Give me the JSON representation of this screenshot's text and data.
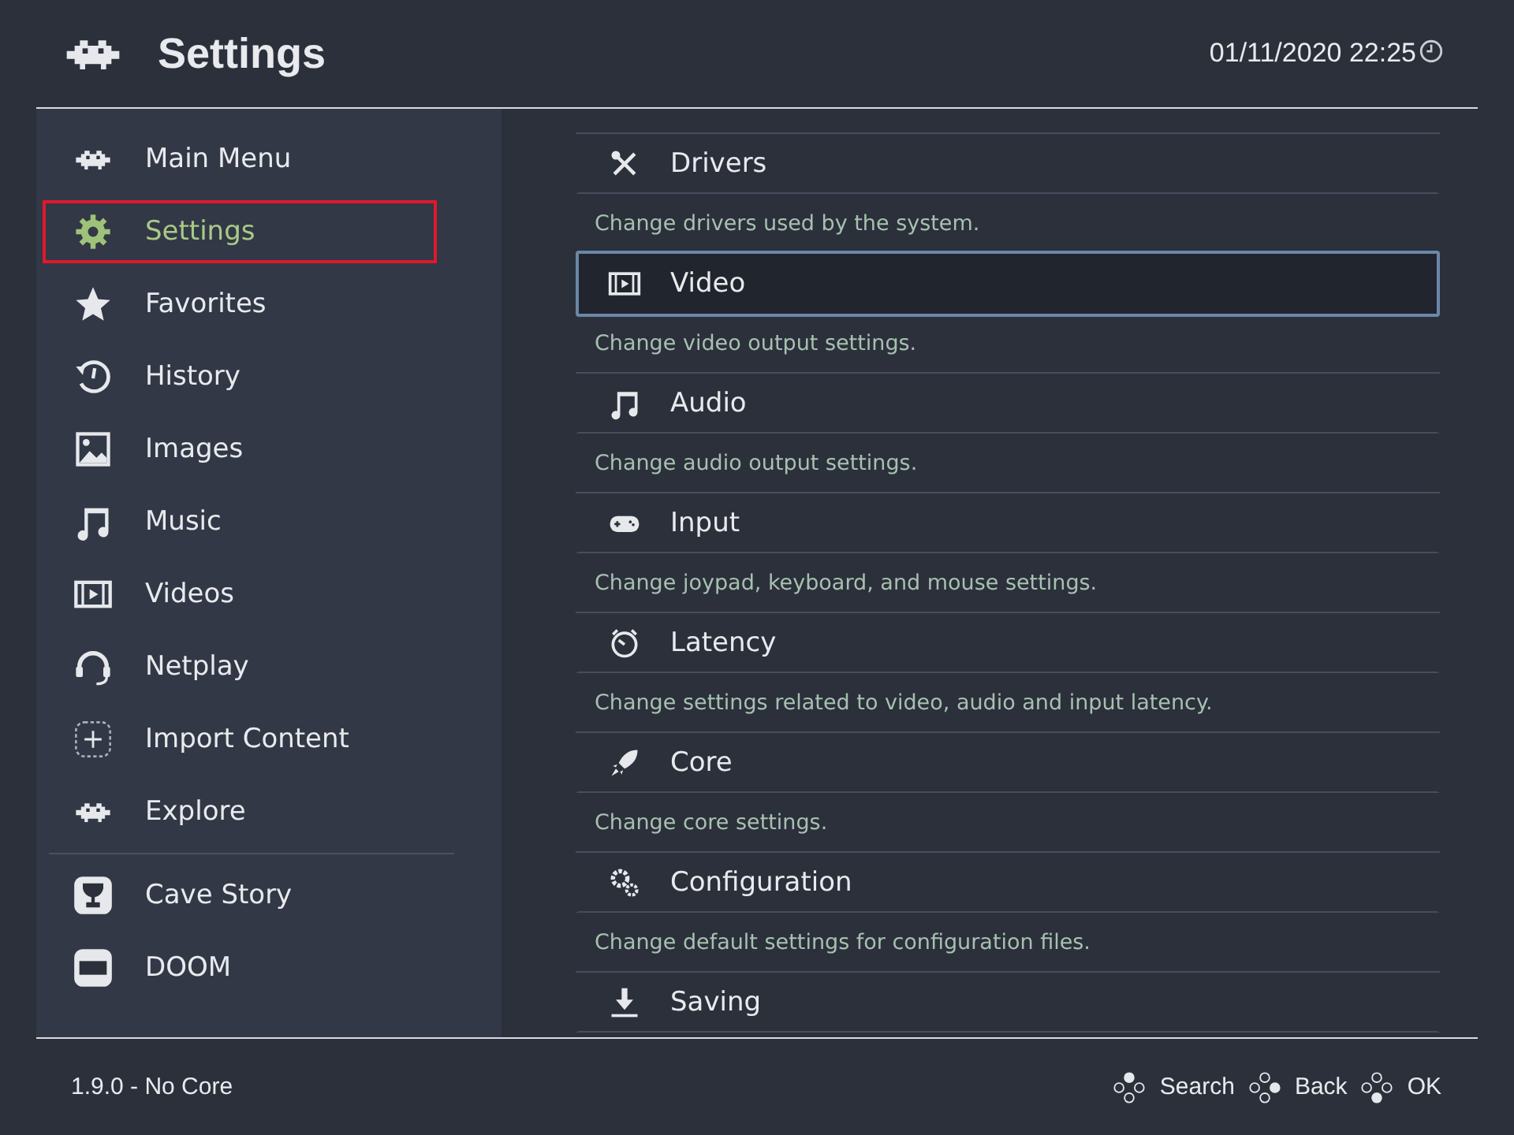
{
  "header": {
    "title": "Settings",
    "datetime": "01/11/2020 22:25"
  },
  "sidebar": {
    "items": [
      {
        "label": "Main Menu",
        "selected": false
      },
      {
        "label": "Settings",
        "selected": true
      },
      {
        "label": "Favorites",
        "selected": false
      },
      {
        "label": "History",
        "selected": false
      },
      {
        "label": "Images",
        "selected": false
      },
      {
        "label": "Music",
        "selected": false
      },
      {
        "label": "Videos",
        "selected": false
      },
      {
        "label": "Netplay",
        "selected": false
      },
      {
        "label": "Import Content",
        "selected": false
      },
      {
        "label": "Explore",
        "selected": false
      }
    ],
    "playlists": [
      {
        "label": "Cave Story",
        "selected": false
      },
      {
        "label": "DOOM",
        "selected": false
      }
    ]
  },
  "menu": {
    "items": [
      {
        "label": "Drivers",
        "description": "Change drivers used by the system.",
        "selected": false
      },
      {
        "label": "Video",
        "description": "Change video output settings.",
        "selected": true
      },
      {
        "label": "Audio",
        "description": "Change audio output settings.",
        "selected": false
      },
      {
        "label": "Input",
        "description": "Change joypad, keyboard, and mouse settings.",
        "selected": false
      },
      {
        "label": "Latency",
        "description": "Change settings related to video, audio and input latency.",
        "selected": false
      },
      {
        "label": "Core",
        "description": "Change core settings.",
        "selected": false
      },
      {
        "label": "Configuration",
        "description": "Change default settings for configuration files.",
        "selected": false
      },
      {
        "label": "Saving",
        "selected": false
      }
    ]
  },
  "footer": {
    "version": "1.9.0 - No Core",
    "hints": [
      {
        "label": "Search"
      },
      {
        "label": "Back"
      },
      {
        "label": "OK"
      }
    ]
  }
}
